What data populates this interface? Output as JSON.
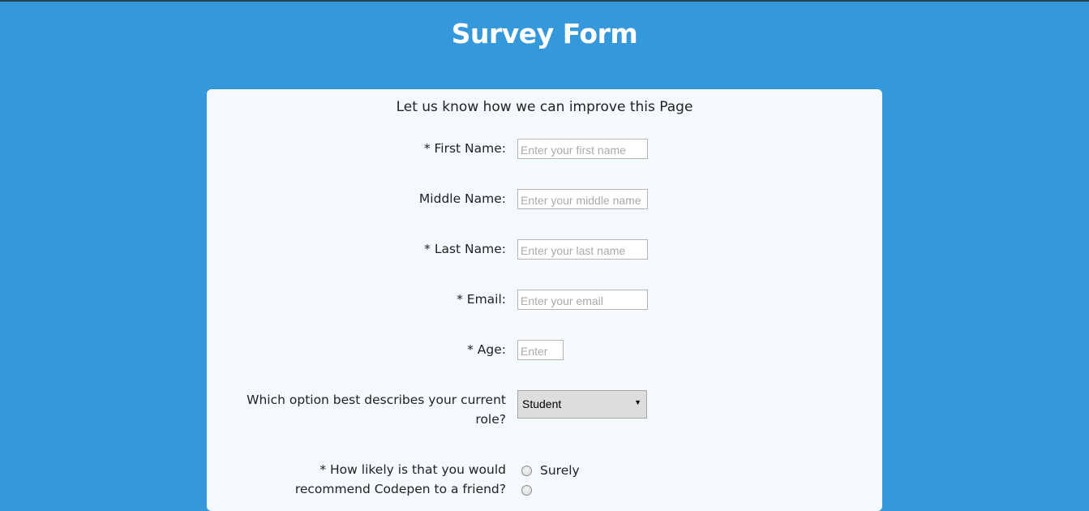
{
  "page": {
    "title": "Survey Form",
    "description": "Let us know how we can improve this Page"
  },
  "form": {
    "first_name": {
      "label": "* First Name:",
      "placeholder": "Enter your first name"
    },
    "middle_name": {
      "label": "Middle Name:",
      "placeholder": "Enter your middle name"
    },
    "last_name": {
      "label": "* Last Name:",
      "placeholder": "Enter your last name"
    },
    "email": {
      "label": "* Email:",
      "placeholder": "Enter your email"
    },
    "age": {
      "label": "* Age:",
      "placeholder": "Enter"
    },
    "role": {
      "label": "Which option best describes your current role?",
      "selected": "Student"
    },
    "recommend": {
      "label": "* How likely is that you would recommend Codepen to a friend?",
      "options": [
        "Surely"
      ]
    }
  },
  "colors": {
    "background": "#3498db",
    "card": "#f4f9fc",
    "text": "#222222"
  }
}
